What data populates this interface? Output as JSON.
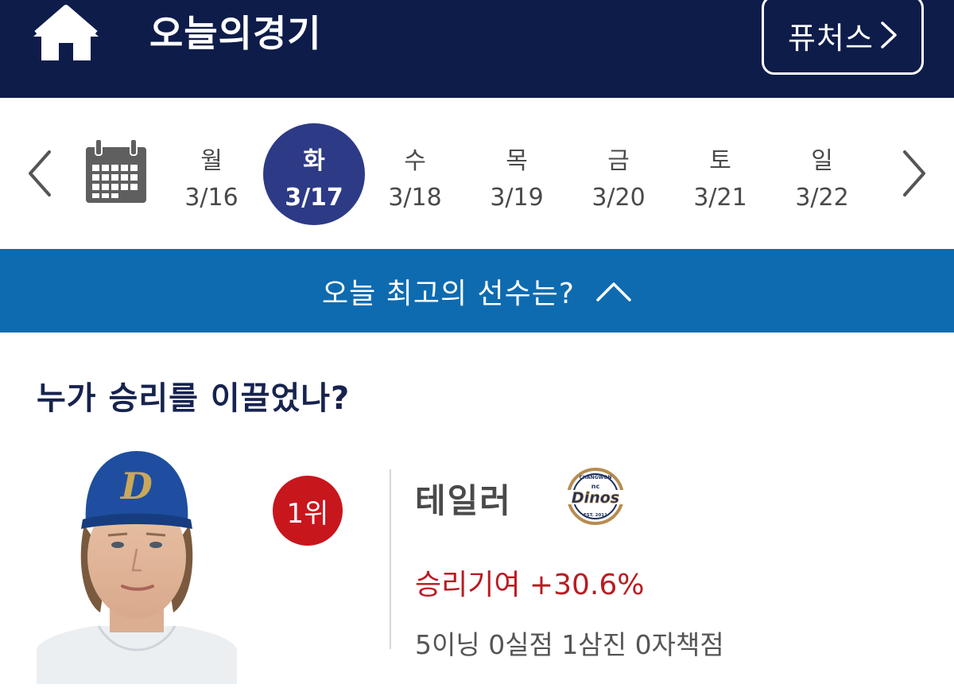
{
  "header": {
    "title": "오늘의경기",
    "purchase_label": "퓨처스",
    "home_icon": "home-icon",
    "background": "#0e1c4a"
  },
  "date_strip": {
    "days": [
      {
        "name": "월",
        "date": "3/16",
        "active": false
      },
      {
        "name": "화",
        "date": "3/17",
        "active": true
      },
      {
        "name": "수",
        "date": "3/18",
        "active": false
      },
      {
        "name": "목",
        "date": "3/19",
        "active": false
      },
      {
        "name": "금",
        "date": "3/20",
        "active": false
      },
      {
        "name": "토",
        "date": "3/21",
        "active": false
      },
      {
        "name": "일",
        "date": "3/22",
        "active": false
      }
    ],
    "active_color": "#2d3a86"
  },
  "banner": {
    "text": "오늘 최고의 선수는?",
    "background": "#0e6bb0"
  },
  "section": {
    "title": "누가 승리를 이끌었나?"
  },
  "player": {
    "rank": "1위",
    "name": "테일러",
    "win_contribution": "승리기여 +30.6%",
    "stats": "5이닝 0실점 1삼진 0자책점",
    "cap_letter": "D",
    "team_logo": {
      "top_text": "CHANGWON",
      "small_text": "nc",
      "main_text": "Dinos",
      "bottom_text": "EST. 2011"
    }
  },
  "colors": {
    "rank_badge": "#c8161d",
    "win_contribution": "#b81c22",
    "section_title": "#17234f"
  }
}
